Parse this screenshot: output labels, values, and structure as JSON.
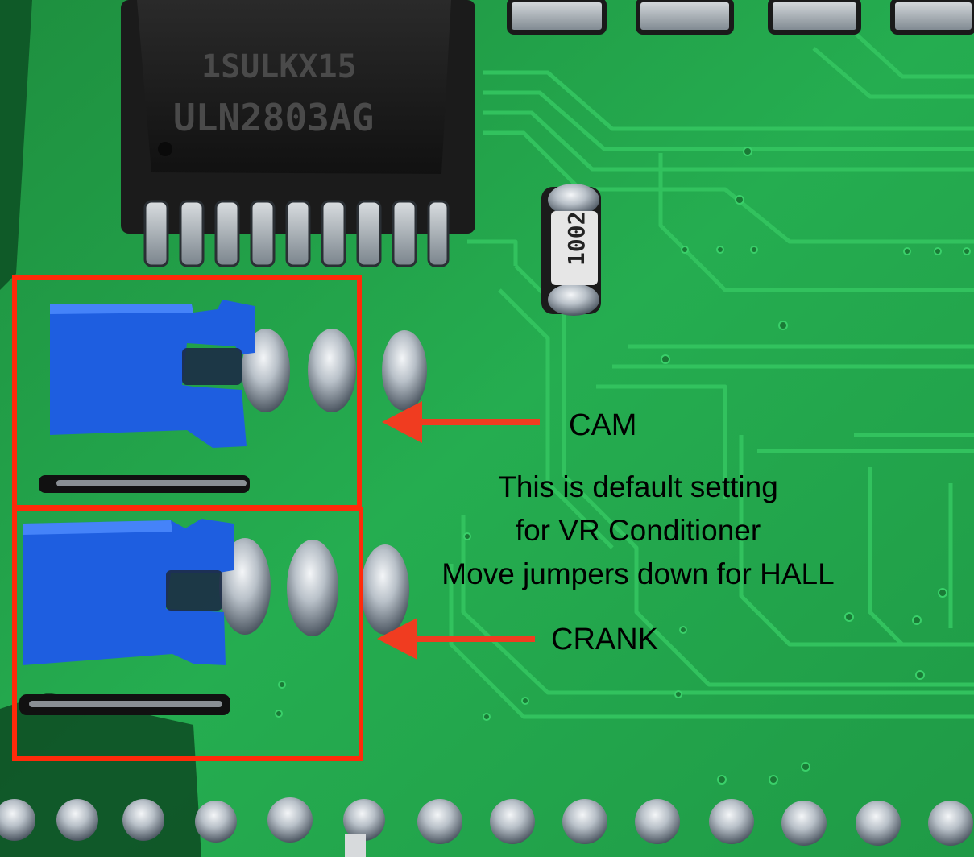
{
  "photo": {
    "chip": {
      "line1": "1SULKX15",
      "line2": "ULN2803AG"
    },
    "resistor_code": "1002"
  },
  "annotations": {
    "cam": "CAM",
    "crank": "CRANK",
    "note_lines": [
      "This is default setting",
      "for VR Conditioner",
      "Move jumpers down for HALL"
    ]
  },
  "colors": {
    "pcb_green": "#22a84c",
    "highlight_box": "#ff2a0a",
    "arrow": "#f03c20",
    "jumper_blue": "#1e5ee0"
  }
}
